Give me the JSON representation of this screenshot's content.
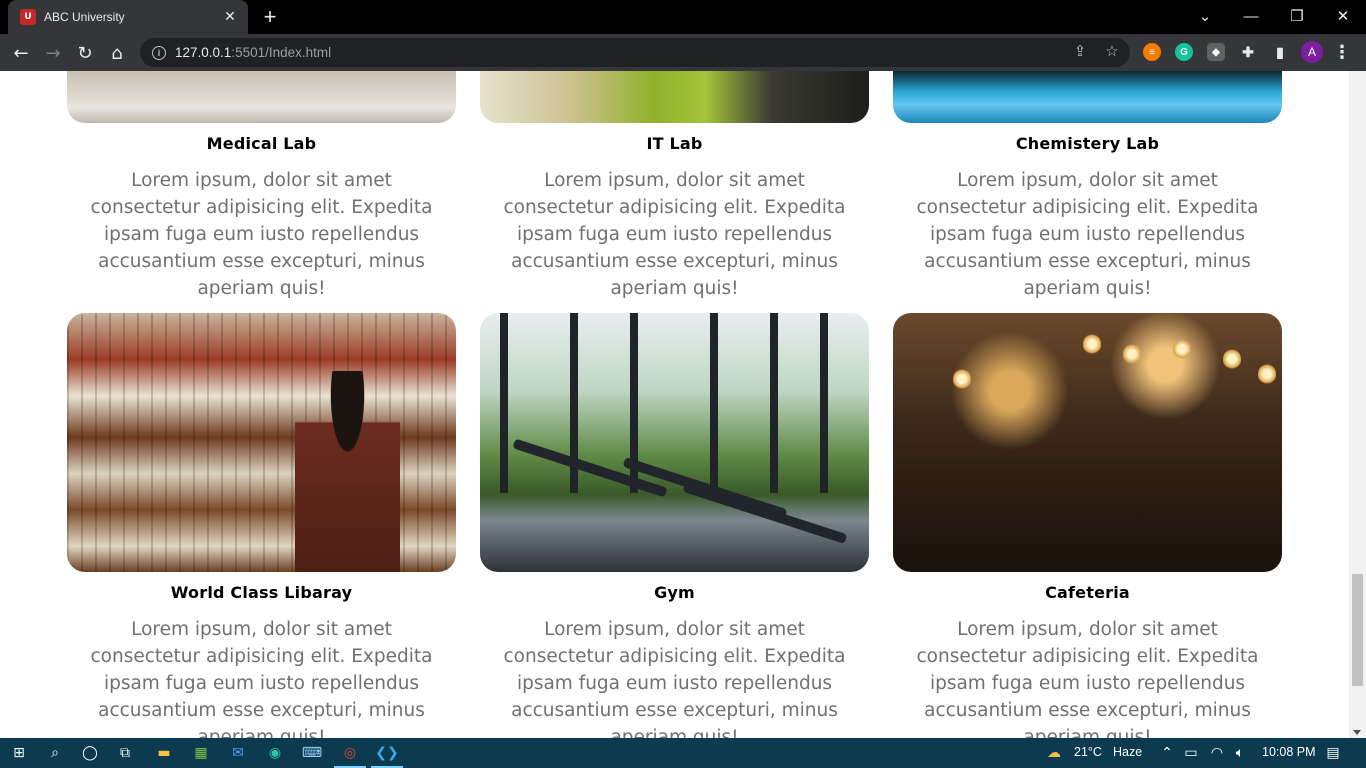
{
  "browser": {
    "tab_title": "ABC University",
    "tab_favicon": "university-crest",
    "url_host": "127.0.0.1",
    "url_rest": ":5501/Index.html",
    "profile_initial": "A"
  },
  "facilities": [
    {
      "title": "Medical Lab",
      "text": "Lorem ipsum, dolor sit amet consectetur adipisicing elit. Expedita ipsam fuga eum iusto repellendus accusantium esse excepturi, minus aperiam quis!"
    },
    {
      "title": "IT Lab",
      "text": "Lorem ipsum, dolor sit amet consectetur adipisicing elit. Expedita ipsam fuga eum iusto repellendus accusantium esse excepturi, minus aperiam quis!"
    },
    {
      "title": "Chemistery Lab",
      "text": "Lorem ipsum, dolor sit amet consectetur adipisicing elit. Expedita ipsam fuga eum iusto repellendus accusantium esse excepturi, minus aperiam quis!"
    },
    {
      "title": "World Class Libaray",
      "text": "Lorem ipsum, dolor sit amet consectetur adipisicing elit. Expedita ipsam fuga eum iusto repellendus accusantium esse excepturi, minus aperiam quis!"
    },
    {
      "title": "Gym",
      "text": "Lorem ipsum, dolor sit amet consectetur adipisicing elit. Expedita ipsam fuga eum iusto repellendus accusantium esse excepturi, minus aperiam quis!"
    },
    {
      "title": "Cafeteria",
      "text": "Lorem ipsum, dolor sit amet consectetur adipisicing elit. Expedita ipsam fuga eum iusto repellendus accusantium esse excepturi, minus aperiam quis!"
    }
  ],
  "taskbar": {
    "weather_temp": "21°C",
    "weather_desc": "Haze",
    "time": "10:08 PM"
  },
  "colors": {
    "taskbar_bg": "#0c3b4f",
    "browser_bg": "#35363a",
    "body_text": "#707070"
  }
}
